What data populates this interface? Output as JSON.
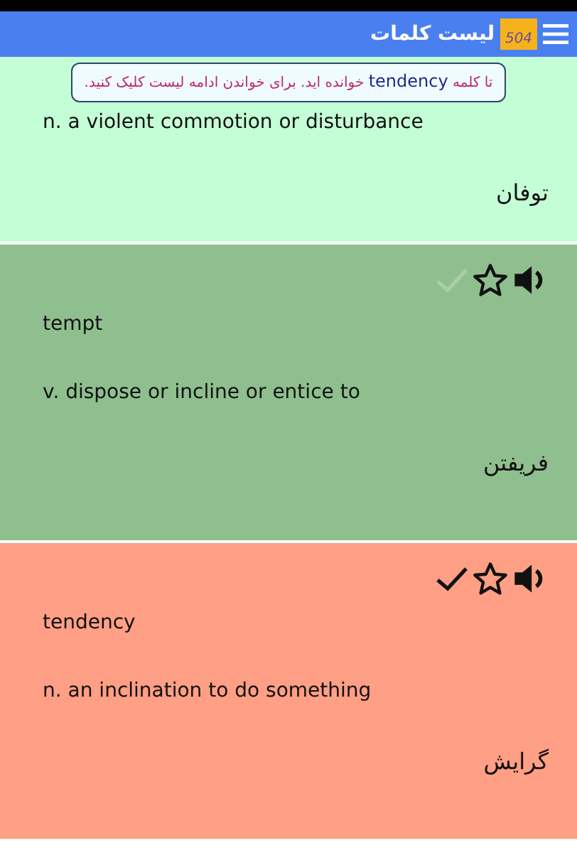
{
  "app_bar": {
    "title": "لیست کلمات",
    "logo_text": "504"
  },
  "toast": {
    "before": "تا کلمه",
    "word": "tendency",
    "after": "خوانده اید. برای خواندن ادامه لیست کلیک کنید."
  },
  "cards": [
    {
      "definition": "n. a violent commotion or disturbance",
      "meaning": "توفان",
      "color": "#c4fed6"
    },
    {
      "word": "tempt",
      "definition": "v. dispose or incline or entice to",
      "meaning": "فریفتن",
      "color": "#8fbf8e",
      "learned": false,
      "starred": false
    },
    {
      "word": "tendency",
      "definition": "n. an inclination to do something",
      "meaning": "گرایش",
      "color": "#ff9f85",
      "learned": true,
      "starred": false
    }
  ]
}
